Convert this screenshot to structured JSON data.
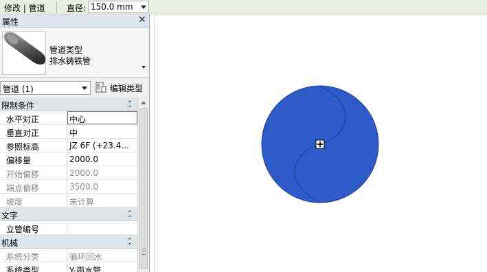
{
  "options_bar": {
    "context": "修改 | 管道",
    "diameter_label": "直径:",
    "diameter_value": "150.0 mm"
  },
  "properties": {
    "title": "属性",
    "type_family": "管道类型",
    "type_name": "排水铸铁管",
    "filter_value": "管道 (1)",
    "edit_type_label": "编辑类型",
    "rows": [
      {
        "kind": "category",
        "label": "限制条件"
      },
      {
        "kind": "prop",
        "name": "水平对正",
        "value": "中心",
        "state": "editing"
      },
      {
        "kind": "prop",
        "name": "垂直对正",
        "value": "中",
        "state": "normal"
      },
      {
        "kind": "prop",
        "name": "参照标高",
        "value": "JZ 6F (+23.4...",
        "state": "normal"
      },
      {
        "kind": "prop",
        "name": "偏移量",
        "value": "2000.0",
        "state": "normal"
      },
      {
        "kind": "prop",
        "name": "开始偏移",
        "value": "2000.0",
        "state": "dim"
      },
      {
        "kind": "prop",
        "name": "端点偏移",
        "value": "3500.0",
        "state": "dim"
      },
      {
        "kind": "prop",
        "name": "坡度",
        "value": "未计算",
        "state": "dim"
      },
      {
        "kind": "category",
        "label": "文字"
      },
      {
        "kind": "prop",
        "name": "立管编号",
        "value": "",
        "state": "normal"
      },
      {
        "kind": "category",
        "label": "机械"
      },
      {
        "kind": "prop",
        "name": "系统分类",
        "value": "循环回水",
        "state": "dim"
      },
      {
        "kind": "prop",
        "name": "系统类型",
        "value": "Y-雨水管",
        "state": "normal"
      }
    ]
  },
  "colors": {
    "pipe_fill": "#2d5bc8",
    "pipe_edge": "#1c3e96",
    "options_bg": "#e9efe0"
  }
}
